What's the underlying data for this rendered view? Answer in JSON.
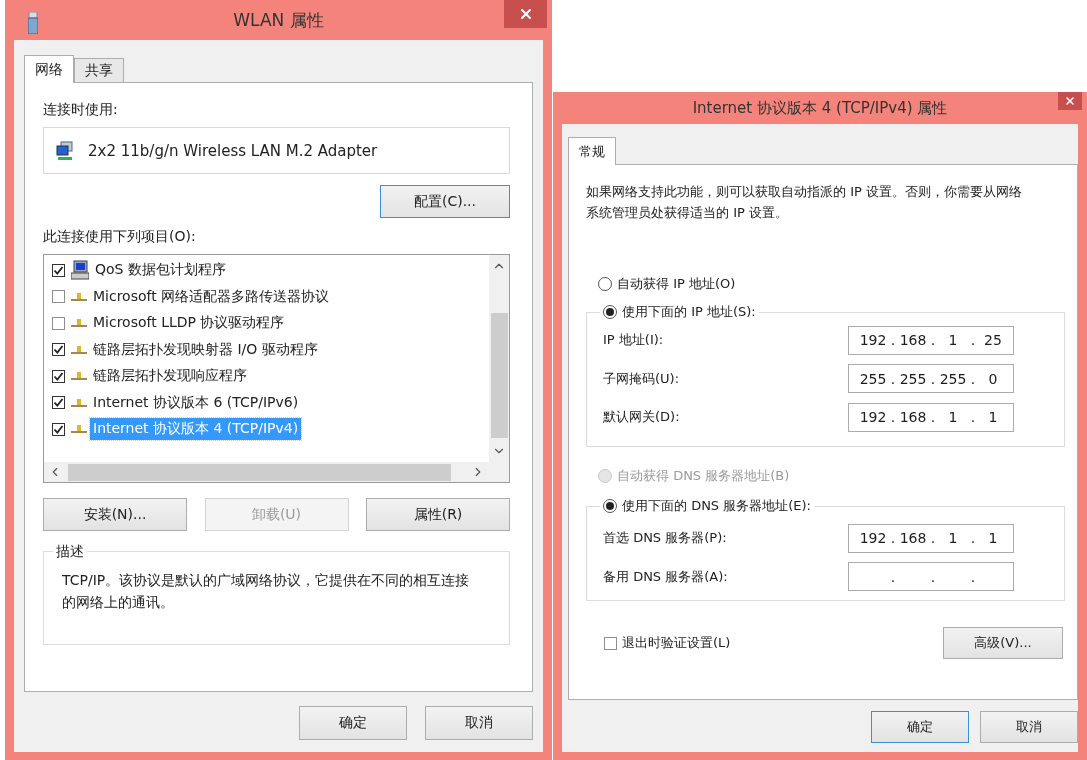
{
  "wlan_dialog": {
    "title": "WLAN 属性",
    "tabs": [
      {
        "label": "网络",
        "selected": true
      },
      {
        "label": "共享",
        "selected": false
      }
    ],
    "connect_using_label": "连接时使用:",
    "adapter": "2x2 11b/g/n Wireless LAN M.2 Adapter",
    "configure_button": {
      "label": "配置(C)...",
      "focused": true
    },
    "items_label": "此连接使用下列项目(O):",
    "items": [
      {
        "label": "QoS 数据包计划程序",
        "checked": true,
        "selected": false,
        "kind": "service"
      },
      {
        "label": "Microsoft 网络适配器多路传送器协议",
        "checked": false,
        "selected": false,
        "kind": "protocol"
      },
      {
        "label": "Microsoft LLDP 协议驱动程序",
        "checked": false,
        "selected": false,
        "kind": "protocol"
      },
      {
        "label": "链路层拓扑发现映射器 I/O 驱动程序",
        "checked": true,
        "selected": false,
        "kind": "protocol"
      },
      {
        "label": "链路层拓扑发现响应程序",
        "checked": true,
        "selected": false,
        "kind": "protocol"
      },
      {
        "label": "Internet 协议版本 6 (TCP/IPv6)",
        "checked": true,
        "selected": false,
        "kind": "protocol"
      },
      {
        "label": "Internet 协议版本 4 (TCP/IPv4)",
        "checked": true,
        "selected": true,
        "kind": "protocol"
      }
    ],
    "buttons": [
      {
        "label": "安装(N)...",
        "disabled": false
      },
      {
        "label": "卸载(U)",
        "disabled": true
      },
      {
        "label": "属性(R)",
        "disabled": false
      }
    ],
    "description": {
      "title": "描述",
      "text": "TCP/IP。该协议是默认的广域网络协议，它提供在不同的相互连接的网络上的通讯。"
    },
    "footer_buttons": [
      {
        "label": "确定",
        "focused": false
      },
      {
        "label": "取消",
        "focused": false
      }
    ]
  },
  "ipv4_dialog": {
    "title": "Internet 协议版本 4 (TCP/IPv4) 属性",
    "tabs": [
      {
        "label": "常规",
        "selected": true
      }
    ],
    "intro": "如果网络支持此功能，则可以获取自动指派的 IP 设置。否则，你需要从网络系统管理员处获得适当的 IP 设置。",
    "octet_separator": ".",
    "ip_mode": [
      {
        "label": "自动获得 IP 地址(O)",
        "selected": false,
        "disabled": false
      },
      {
        "label": "使用下面的 IP 地址(S):",
        "selected": true,
        "disabled": false
      }
    ],
    "ip_fields": [
      {
        "label": "IP 地址(I):",
        "octets": [
          "192",
          "168",
          "1",
          "25"
        ]
      },
      {
        "label": "子网掩码(U):",
        "octets": [
          "255",
          "255",
          "255",
          "0"
        ]
      },
      {
        "label": "默认网关(D):",
        "octets": [
          "192",
          "168",
          "1",
          "1"
        ]
      }
    ],
    "dns_mode": [
      {
        "label": "自动获得 DNS 服务器地址(B)",
        "selected": false,
        "disabled": true
      },
      {
        "label": "使用下面的 DNS 服务器地址(E):",
        "selected": true,
        "disabled": false
      }
    ],
    "dns_fields": [
      {
        "label": "首选 DNS 服务器(P):",
        "octets": [
          "192",
          "168",
          "1",
          "1"
        ]
      },
      {
        "label": "备用 DNS 服务器(A):"
      }
    ],
    "validate_on_exit": {
      "label": "退出时验证设置(L)",
      "checked": false
    },
    "advanced_button": {
      "label": "高级(V)...",
      "focused": false
    },
    "footer_buttons": [
      {
        "label": "确定",
        "focused": true
      },
      {
        "label": "取消",
        "focused": false
      }
    ]
  }
}
